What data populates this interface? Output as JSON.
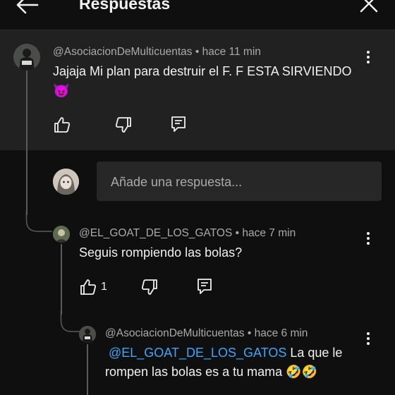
{
  "header": {
    "title": "Respuestas",
    "back_icon": "arrow-left-icon",
    "close_icon": "close-icon"
  },
  "top_comment": {
    "author": "@AsociacionDeMulticuentas",
    "separator": "•",
    "time": "hace 11 min",
    "text": "Jajaja Mi plan para destruir el F. F ESTA SIRVIENDO",
    "emoji": "😈"
  },
  "reply_input": {
    "placeholder": "Añade una respuesta..."
  },
  "replies": [
    {
      "author": "@EL_GOAT_DE_LOS_GATOS",
      "separator": "•",
      "time": "hace 7 min",
      "text": "Seguis rompiendo las bolas?",
      "like_count": "1"
    },
    {
      "author": "@AsociacionDeMulticuentas",
      "separator": "•",
      "time": "hace 6 min",
      "mention": "@EL_GOAT_DE_LOS_GATOS",
      "text_line1_rest": " La que le",
      "text_line2": "rompen las bolas es a tu mama",
      "emoji": "🤣🤣"
    }
  ],
  "colors": {
    "background": "#0f0f0f",
    "highlight": "#212121",
    "input_bg": "#272727",
    "mention": "#3ea6ff",
    "meta": "#aaaaaa"
  }
}
